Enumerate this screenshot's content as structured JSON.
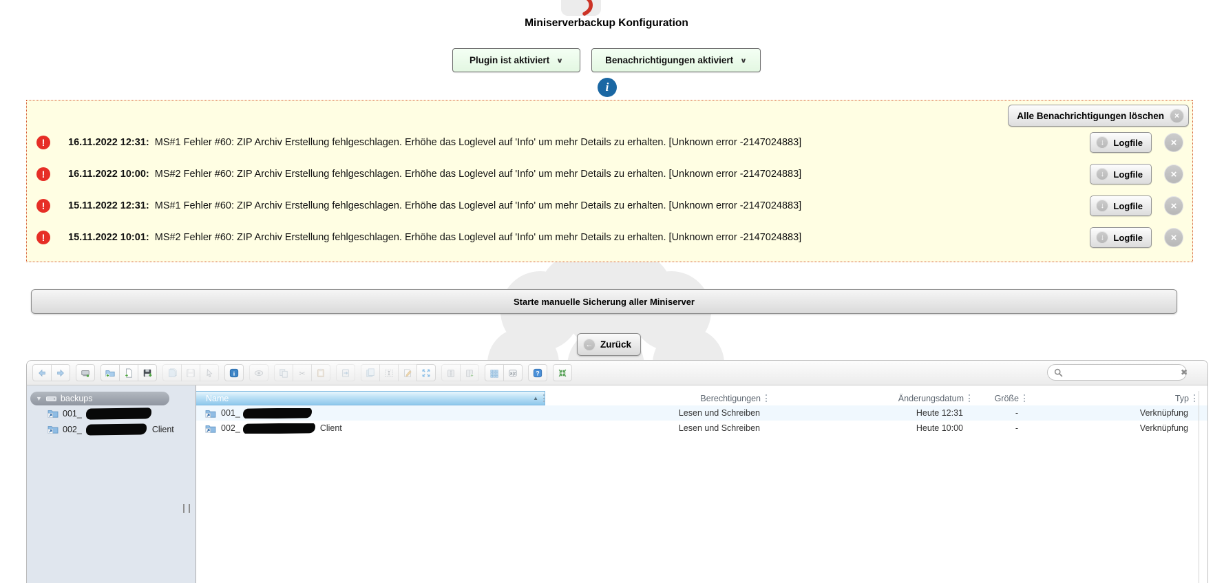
{
  "header": {
    "title": "Miniserverbackup Konfiguration"
  },
  "controls": {
    "plugin_select_value": "Plugin ist aktiviert",
    "notify_select_value": "Benachrichtigungen aktiviert"
  },
  "notifications": {
    "clear_all_label": "Alle Benachrichtigungen löschen",
    "logfile_label": "Logfile",
    "items": [
      {
        "timestamp": "16.11.2022 12:31:",
        "message": "MS#1 Fehler #60: ZIP Archiv Erstellung fehlgeschlagen. Erhöhe das Loglevel auf 'Info' um mehr Details zu erhalten. [Unknown error -2147024883]"
      },
      {
        "timestamp": "16.11.2022 10:00:",
        "message": "MS#2 Fehler #60: ZIP Archiv Erstellung fehlgeschlagen. Erhöhe das Loglevel auf 'Info' um mehr Details zu erhalten. [Unknown error -2147024883]"
      },
      {
        "timestamp": "15.11.2022 12:31:",
        "message": "MS#1 Fehler #60: ZIP Archiv Erstellung fehlgeschlagen. Erhöhe das Loglevel auf 'Info' um mehr Details zu erhalten. [Unknown error -2147024883]"
      },
      {
        "timestamp": "15.11.2022 10:01:",
        "message": "MS#2 Fehler #60: ZIP Archiv Erstellung fehlgeschlagen. Erhöhe das Loglevel auf 'Info' um mehr Details zu erhalten. [Unknown error -2147024883]"
      }
    ]
  },
  "actions": {
    "manual_backup_label": "Starte manuelle Sicherung aller Miniserver",
    "back_label": "Zurück"
  },
  "filemanager": {
    "search_placeholder": "",
    "search_value": "",
    "toolbar_groups": [
      {
        "items": [
          {
            "icon": "history-back",
            "enabled": true
          },
          {
            "icon": "history-forward",
            "enabled": true
          }
        ]
      },
      {
        "items": [
          {
            "icon": "netmount",
            "enabled": true
          }
        ]
      },
      {
        "items": [
          {
            "icon": "new-folder",
            "enabled": true
          },
          {
            "icon": "new-file",
            "enabled": true
          },
          {
            "icon": "upload",
            "enabled": true
          }
        ]
      },
      {
        "items": [
          {
            "icon": "open",
            "enabled": false
          },
          {
            "icon": "save",
            "enabled": false
          },
          {
            "icon": "select-file",
            "enabled": false
          }
        ]
      },
      {
        "items": [
          {
            "icon": "info",
            "enabled": true
          }
        ]
      },
      {
        "items": [
          {
            "icon": "preview",
            "enabled": false
          }
        ]
      },
      {
        "items": [
          {
            "icon": "copy",
            "enabled": false
          },
          {
            "icon": "cut",
            "enabled": false
          },
          {
            "icon": "paste",
            "enabled": false
          }
        ]
      },
      {
        "items": [
          {
            "icon": "restore",
            "enabled": false
          }
        ]
      },
      {
        "items": [
          {
            "icon": "duplicate",
            "enabled": false
          },
          {
            "icon": "rename",
            "enabled": false
          },
          {
            "icon": "edit",
            "enabled": false
          },
          {
            "icon": "resize",
            "enabled": true
          }
        ]
      },
      {
        "items": [
          {
            "icon": "archive",
            "enabled": false
          },
          {
            "icon": "archive-add",
            "enabled": false
          }
        ]
      },
      {
        "items": [
          {
            "icon": "view-list",
            "enabled": true
          },
          {
            "icon": "sort",
            "enabled": true
          }
        ]
      },
      {
        "items": [
          {
            "icon": "help",
            "enabled": true
          }
        ]
      },
      {
        "items": [
          {
            "icon": "fullscreen",
            "enabled": true
          }
        ]
      }
    ],
    "tree": {
      "root_label": "backups",
      "items": [
        {
          "prefix": "001_",
          "redacted_width": 95,
          "suffix": ""
        },
        {
          "prefix": "002_",
          "redacted_width": 88,
          "suffix": "Client"
        }
      ]
    },
    "table": {
      "columns": {
        "name": "Name",
        "perm": "Berechtigungen",
        "date": "Änderungsdatum",
        "size": "Größe",
        "type": "Typ"
      },
      "rows": [
        {
          "name_prefix": "001_",
          "redacted_width": 100,
          "name_suffix": "",
          "perm": "Lesen und Schreiben",
          "date": "Heute 12:31",
          "size": "-",
          "type": "Verknüpfung"
        },
        {
          "name_prefix": "002_",
          "redacted_width": 105,
          "name_suffix": "Client",
          "perm": "Lesen und Schreiben",
          "date": "Heute 10:00",
          "size": "-",
          "type": "Verknüpfung"
        }
      ]
    }
  },
  "colors": {
    "accent_blue": "#1a67a3",
    "error_red": "#e62e26",
    "panel_yellow": "#fffee3",
    "panel_border": "#d4552f",
    "select_green": "#e9f9e8",
    "header_blue": "#8fc8ec",
    "tree_bg": "#e0e6ee",
    "row_alt": "#f0f8fe"
  }
}
